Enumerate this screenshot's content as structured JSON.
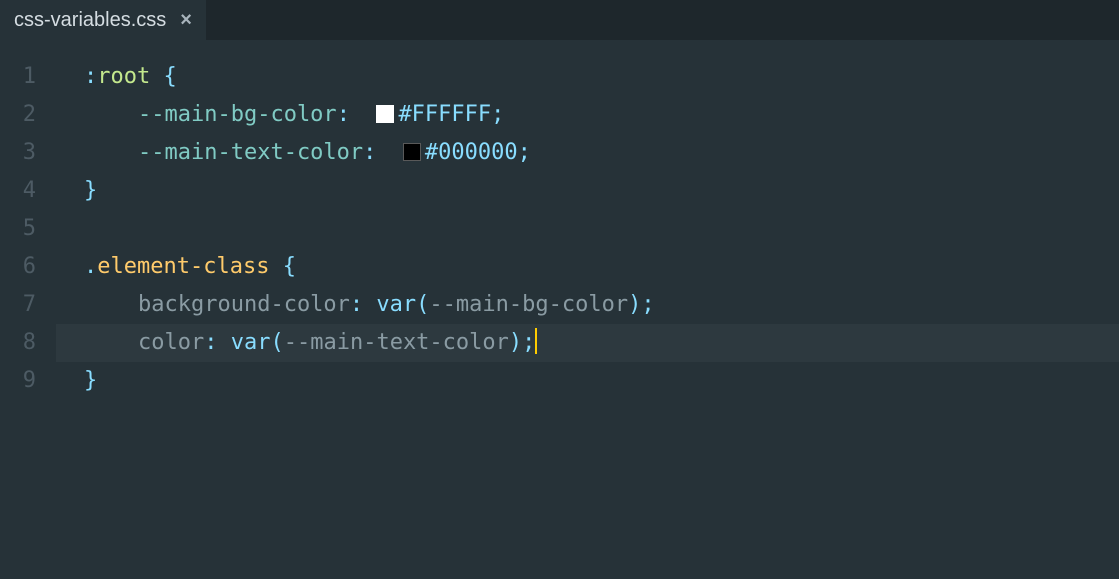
{
  "tab": {
    "filename": "css-variables.css",
    "close_glyph": "×"
  },
  "gutter": {
    "numbers": [
      "1",
      "2",
      "3",
      "4",
      "5",
      "6",
      "7",
      "8",
      "9"
    ]
  },
  "code": {
    "l1": {
      "selector": ":root",
      "brace": "{"
    },
    "l2": {
      "prop": "--main-bg-color",
      "colon": ":",
      "hex": "#FFFFFF",
      "semi": ";"
    },
    "l3": {
      "prop": "--main-text-color",
      "colon": ":",
      "hex": "#000000",
      "semi": ";"
    },
    "l4": {
      "brace": "}"
    },
    "l6": {
      "selector": ".element-class",
      "brace": "{"
    },
    "l7": {
      "prop": "background-color",
      "colon": ":",
      "func": "var",
      "lp": "(",
      "arg": "--main-bg-color",
      "rp": ")",
      "semi": ";"
    },
    "l8": {
      "prop": "color",
      "colon": ":",
      "func": "var",
      "lp": "(",
      "arg": "--main-text-color",
      "rp": ")",
      "semi": ";"
    },
    "l9": {
      "brace": "}"
    }
  },
  "colors": {
    "swatch1": "#FFFFFF",
    "swatch2": "#000000"
  }
}
